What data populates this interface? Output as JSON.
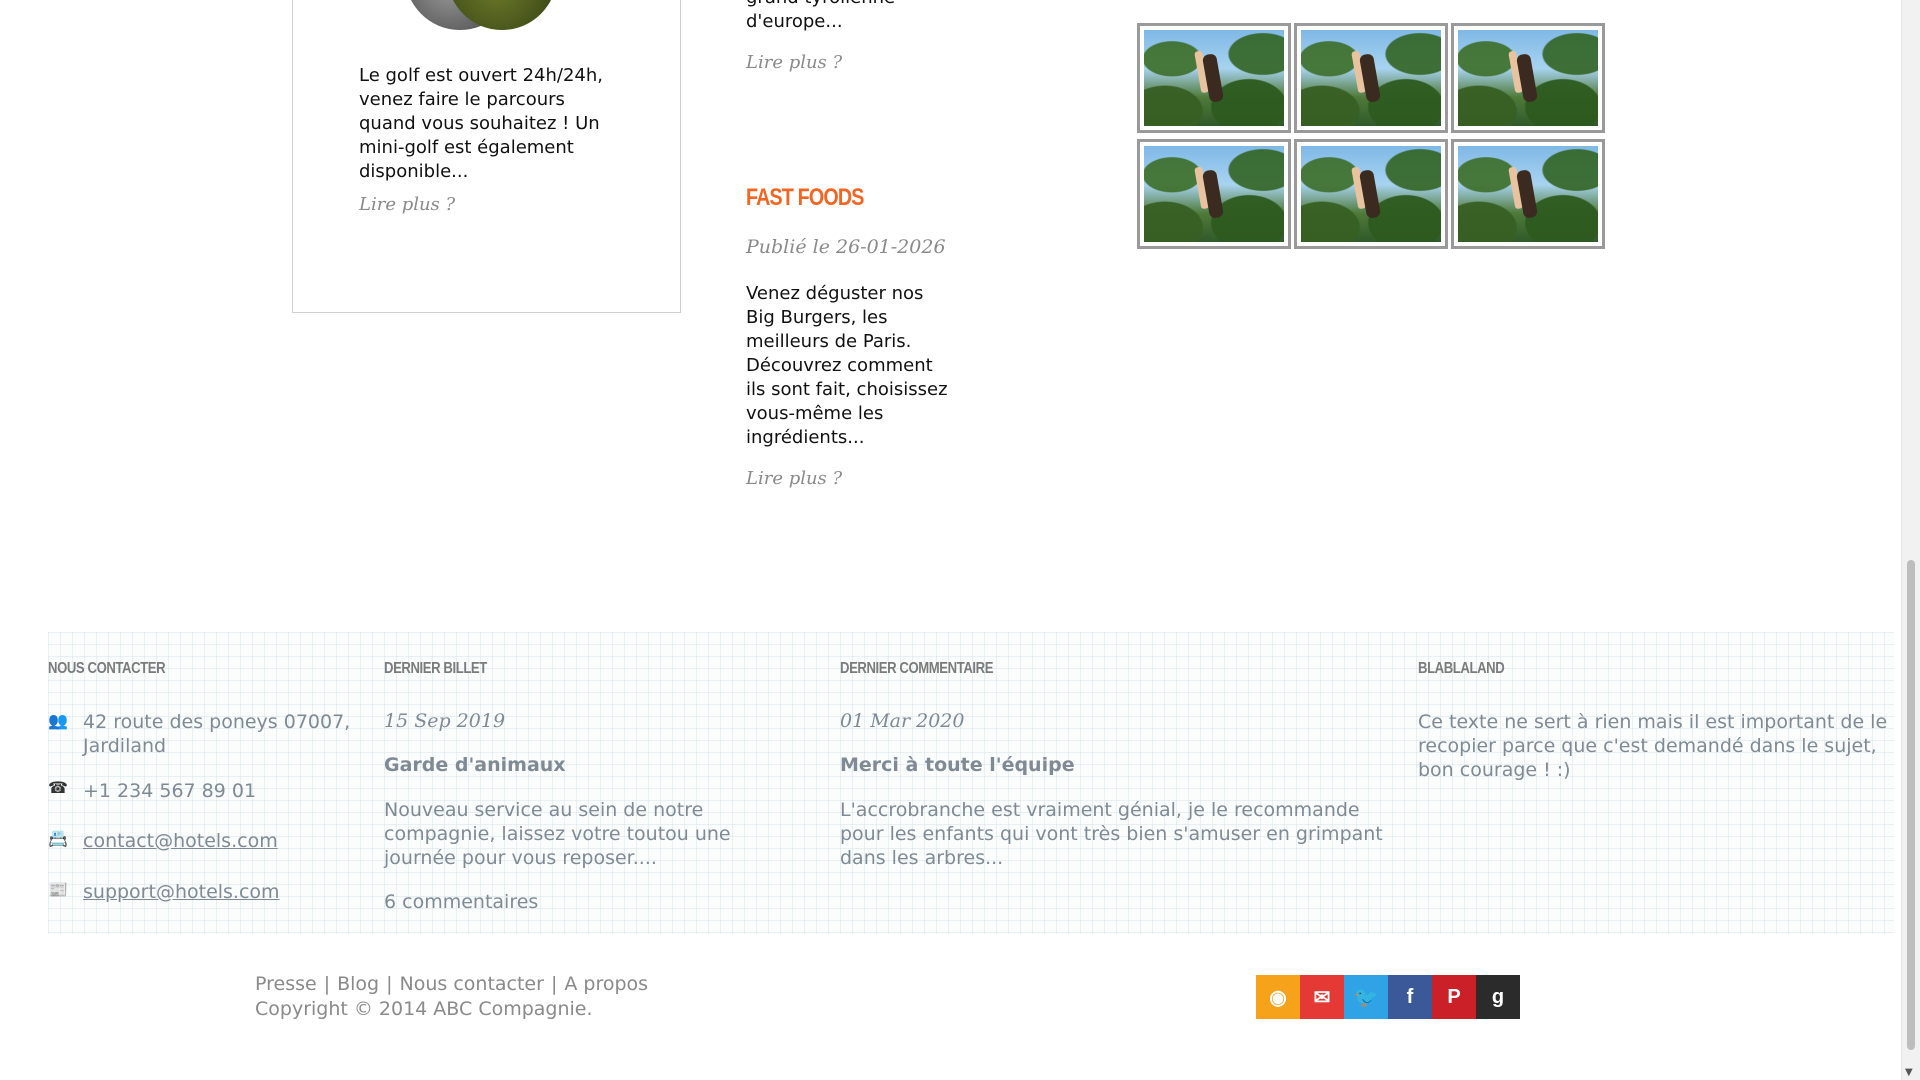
{
  "cards": {
    "golf": {
      "text": "Le golf est ouvert 24h/24h, venez faire le parcours quand vous souhaitez ! Un mini-golf est également disponible...",
      "read_more": "Lire plus ?"
    }
  },
  "middle": {
    "top_text": "grand tyrolienne d'europe...",
    "top_read_more": "Lire plus ?",
    "fastfood": {
      "title": "FAST FOODS",
      "date": "Publié le 26-01-2026",
      "text": "Venez déguster nos Big Burgers, les meilleurs de Paris. Découvrez comment ils sont fait, choisissez vous-même les ingrédients...",
      "read_more": "Lire plus ?"
    }
  },
  "footer": {
    "contact": {
      "heading": "NOUS CONTACTER",
      "address": "42 route des poneys 07007, Jardiland",
      "phone": "+1 234 567 89 01",
      "email1": "contact@hotels.com",
      "email2": "support@hotels.com"
    },
    "last_post": {
      "heading": "DERNIER BILLET",
      "date": "15 Sep 2019",
      "title": "Garde d'animaux",
      "text": "Nouveau service au sein de notre compagnie, laissez votre toutou une journée pour vous reposer....",
      "comments": "6 commentaires"
    },
    "last_comment": {
      "heading": "DERNIER COMMENTAIRE",
      "date": "01 Mar 2020",
      "title": "Merci à toute l'équipe",
      "text": "L'accrobranche est vraiment génial, je le recommande pour les enfants qui vont très bien s'amuser en grimpant dans les arbres..."
    },
    "blablaland": {
      "heading": "BLABLALAND",
      "text": "Ce texte ne sert à rien mais il est important de le recopier parce que c'est demandé dans le sujet, bon courage ! :)"
    }
  },
  "bottom": {
    "links": [
      "Presse",
      "Blog",
      "Nous contacter",
      "A propos"
    ],
    "separator": "|",
    "copyright": "Copyright © 2014 ABC Compagnie."
  },
  "social": [
    {
      "name": "rss-icon",
      "glyph": "◉",
      "color": "#f7a21b"
    },
    {
      "name": "mail-icon",
      "glyph": "✉",
      "color": "#e53935"
    },
    {
      "name": "twitter-icon",
      "glyph": "🐦",
      "color": "#2fa3e6"
    },
    {
      "name": "facebook-icon",
      "glyph": "f",
      "color": "#3b5998"
    },
    {
      "name": "pinterest-icon",
      "glyph": "P",
      "color": "#cb2027"
    },
    {
      "name": "google-icon",
      "glyph": "g",
      "color": "#2b2b2b"
    }
  ],
  "colors": {
    "accent": "#f26522",
    "muted_text": "#7f8a94"
  }
}
